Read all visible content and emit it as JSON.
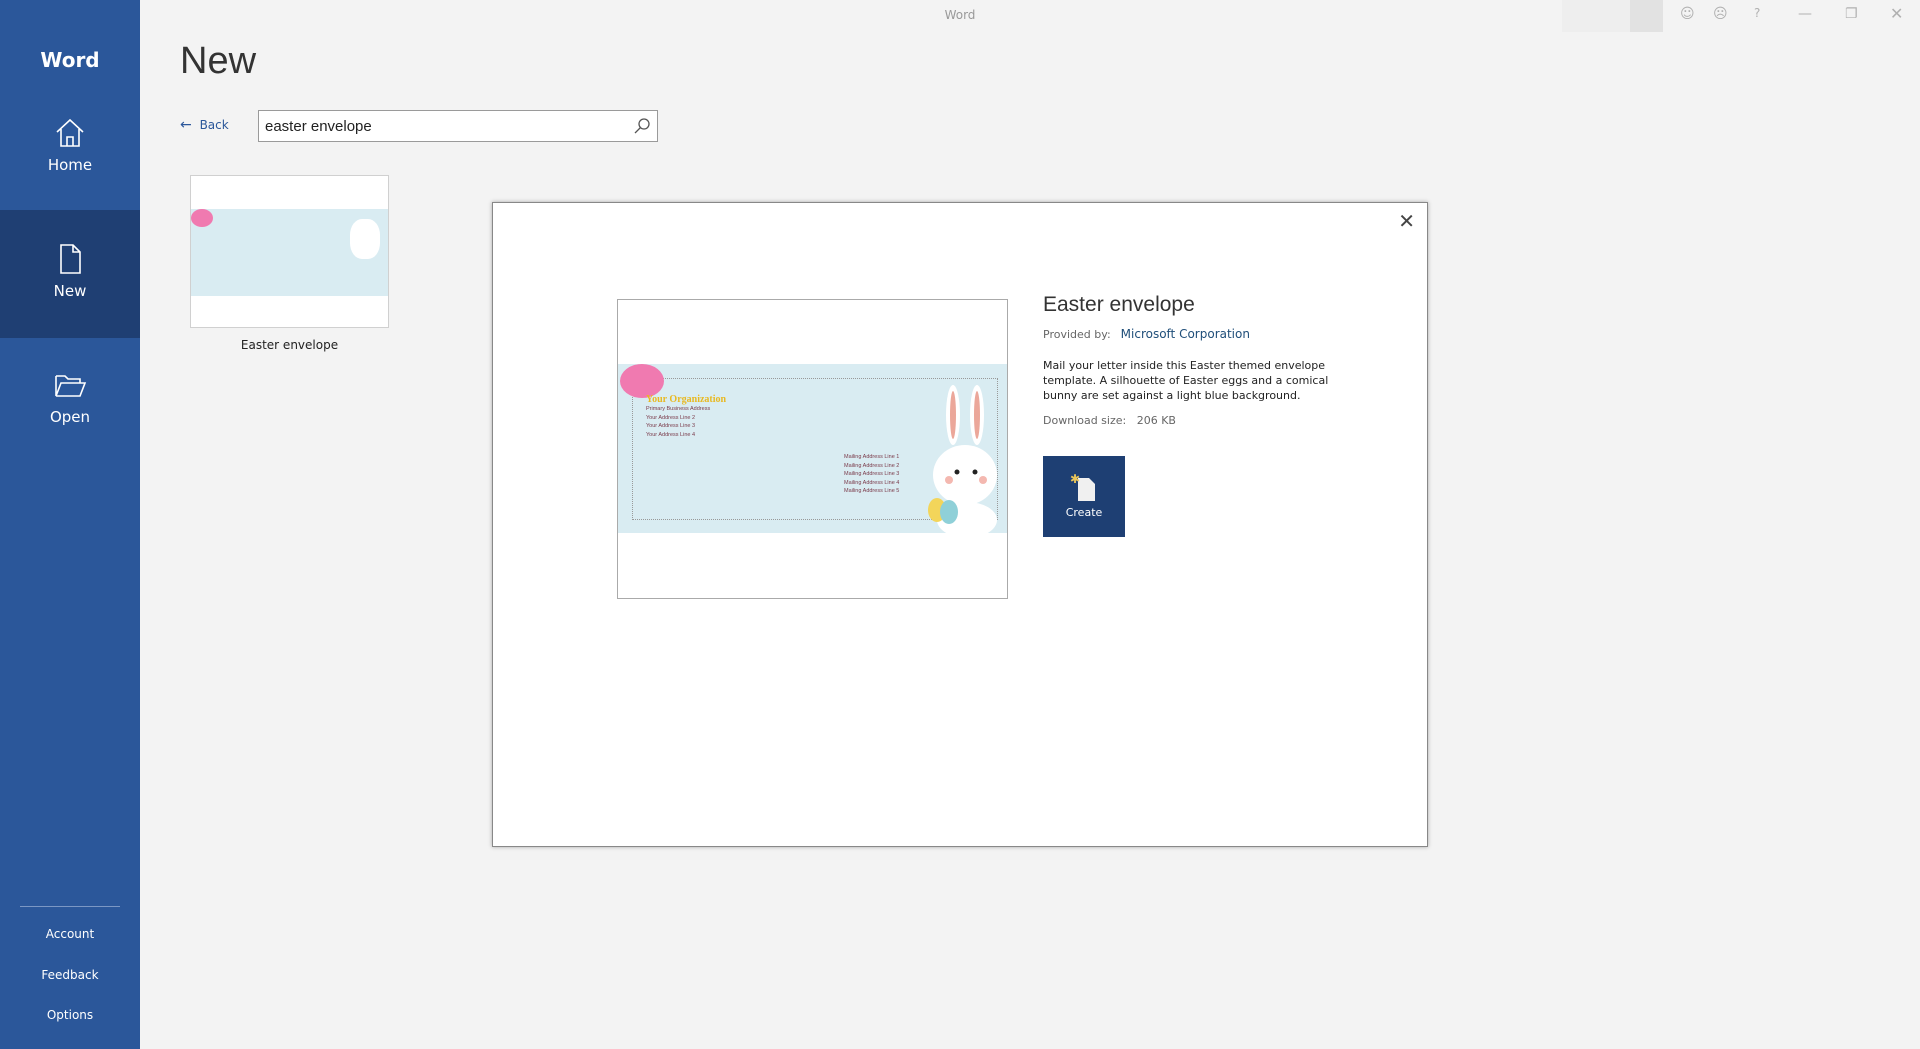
{
  "window": {
    "title": "Word"
  },
  "sidebar": {
    "app_name": "Word",
    "items": [
      {
        "label": "Home",
        "icon": "home-icon"
      },
      {
        "label": "New",
        "icon": "new-document-icon",
        "selected": true
      },
      {
        "label": "Open",
        "icon": "folder-open-icon"
      }
    ],
    "bottom": [
      {
        "label": "Account"
      },
      {
        "label": "Feedback"
      },
      {
        "label": "Options"
      }
    ]
  },
  "main": {
    "heading": "New",
    "back_label": "Back",
    "search": {
      "value": "easter envelope"
    },
    "results": [
      {
        "label": "Easter envelope"
      }
    ]
  },
  "dialog": {
    "title": "Easter envelope",
    "provided_by_label": "Provided by:",
    "provider": "Microsoft Corporation",
    "description": "Mail your letter inside this Easter themed envelope template. A silhouette of Easter eggs and a comical bunny are set against a light blue background.",
    "download_label": "Download size:",
    "download_size": "206 KB",
    "create_label": "Create",
    "preview": {
      "org": "Your Organization",
      "return_lines": [
        "Primary Business Address",
        "Your Address Line 2",
        "Your Address Line 3",
        "Your Address Line 4"
      ],
      "mailing_lines": [
        "Mailing Address Line 1",
        "Mailing Address Line 2",
        "Mailing Address Line 3",
        "Mailing Address Line 4",
        "Mailing Address Line 5"
      ]
    }
  },
  "colors": {
    "brand": "#2b579a",
    "selected_nav": "#1f3f73",
    "create_button": "#1e3f73"
  }
}
